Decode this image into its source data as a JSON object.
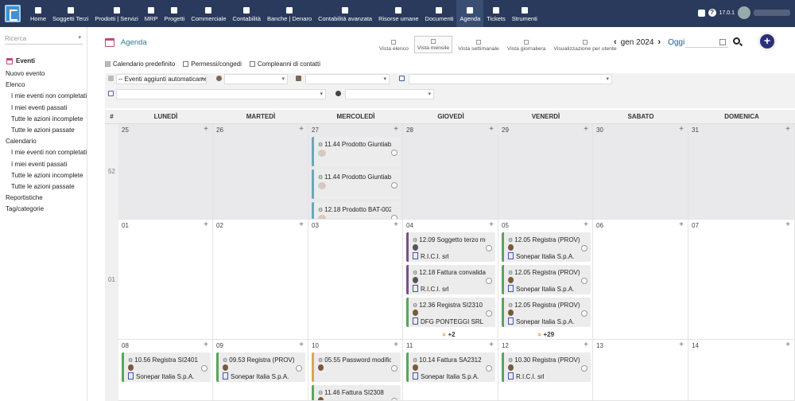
{
  "topbar": {
    "nav": [
      {
        "label": "Home",
        "icon": "home-icon"
      },
      {
        "label": "Soggetti Terzi",
        "icon": "building-icon"
      },
      {
        "label": "Prodotti | Servizi",
        "icon": "box-icon"
      },
      {
        "label": "MRP",
        "icon": "gears-icon"
      },
      {
        "label": "Progetti",
        "icon": "chart-icon"
      },
      {
        "label": "Commerciale",
        "icon": "briefcase-icon"
      },
      {
        "label": "Contabilità",
        "icon": "ledger-icon"
      },
      {
        "label": "Banche | Denaro",
        "icon": "bank-icon"
      },
      {
        "label": "Contabilità avanzata",
        "icon": "search-icon"
      },
      {
        "label": "Risorse umane",
        "icon": "user-icon"
      },
      {
        "label": "Documenti",
        "icon": "folder-icon"
      },
      {
        "label": "Agenda",
        "icon": "calendar-icon"
      },
      {
        "label": "Tickets",
        "icon": "ticket-icon"
      },
      {
        "label": "Strumenti",
        "icon": "wrench-icon"
      }
    ],
    "version": "17.0.1"
  },
  "sidebar": {
    "search_placeholder": "Ricerca",
    "section": "Eventi",
    "items": [
      {
        "label": "Nuovo evento",
        "sub": false
      },
      {
        "label": "Elenco",
        "sub": false
      },
      {
        "label": "I mie eventi non completati",
        "sub": true
      },
      {
        "label": "I miei eventi passati",
        "sub": true
      },
      {
        "label": "Tutte le azioni incomplete",
        "sub": true
      },
      {
        "label": "Tutte le azioni passate",
        "sub": true
      },
      {
        "label": "Calendario",
        "sub": false
      },
      {
        "label": "I mie eventi non completati",
        "sub": true
      },
      {
        "label": "I miei eventi passati",
        "sub": true
      },
      {
        "label": "Tutte le azioni incomplete",
        "sub": true
      },
      {
        "label": "Tutte le azioni passate",
        "sub": true
      },
      {
        "label": "Reportistiche",
        "sub": false
      },
      {
        "label": "Tag/categorie",
        "sub": false
      }
    ]
  },
  "header": {
    "title": "Agenda",
    "views": [
      "Vista elenco",
      "Vista mensile",
      "Vista settimanale",
      "Vista giornaliera",
      "Visualizzazione per utente"
    ],
    "active_view": 1,
    "month": "gen 2024",
    "today": "Oggi"
  },
  "checks": [
    {
      "label": "Calendario predefinito",
      "checked": true
    },
    {
      "label": "Permessi/congedi",
      "checked": false
    },
    {
      "label": "Compleanni di contatti",
      "checked": false
    }
  ],
  "filters": {
    "events_select": "-- Eventi aggiunti automaticamente --"
  },
  "calendar": {
    "week_header": "#",
    "days": [
      "LUNEDÌ",
      "MARTEDÌ",
      "MERCOLEDÌ",
      "GIOVEDÌ",
      "VENERDÌ",
      "SABATO",
      "DOMENICA"
    ],
    "weeks": [
      {
        "num": "52",
        "days": [
          {
            "d": "25",
            "grey": true,
            "events": []
          },
          {
            "d": "26",
            "grey": true,
            "events": []
          },
          {
            "d": "27",
            "grey": true,
            "events": [
              {
                "t": "11.44 Prodotto Giuntiabc",
                "c": "",
                "color": "#6aa7b8",
                "blur": true
              },
              {
                "t": "11.44 Prodotto Giuntiabc",
                "c": "",
                "color": "#6aa7b8",
                "blur": true
              },
              {
                "t": "12.18 Prodotto BAT-0021",
                "c": "",
                "color": "#6aa7b8",
                "blur": true
              }
            ],
            "more": "+1"
          },
          {
            "d": "28",
            "grey": true,
            "events": []
          },
          {
            "d": "29",
            "grey": true,
            "events": []
          },
          {
            "d": "30",
            "grey": true,
            "events": []
          },
          {
            "d": "31",
            "grey": true,
            "events": []
          }
        ]
      },
      {
        "num": "01",
        "days": [
          {
            "d": "01",
            "grey": false,
            "events": []
          },
          {
            "d": "02",
            "grey": false,
            "events": []
          },
          {
            "d": "03",
            "grey": false,
            "events": []
          },
          {
            "d": "04",
            "grey": false,
            "events": [
              {
                "t": "12.09 Soggetto terzo modificato",
                "c": "R.I.C.I. srl",
                "color": "#7b4f8c",
                "pg": true
              },
              {
                "t": "12.18 Fattura convalidata",
                "c": "R.I.C.I. srl",
                "color": "#7b4f8c",
                "pg": true
              },
              {
                "t": "12.36 Registra SI2310",
                "c": "DFG PONTEGGI SRL",
                "color": "#5aa55a"
              }
            ],
            "more": "+2"
          },
          {
            "d": "05",
            "grey": false,
            "events": [
              {
                "t": "12.05 Registra (PROV)",
                "c": "Sonepar Italia S.p.A.",
                "color": "#5aa55a"
              },
              {
                "t": "12.05 Registra (PROV)",
                "c": "Sonepar Italia S.p.A.",
                "color": "#5aa55a"
              },
              {
                "t": "12.05 Registra (PROV)",
                "c": "Sonepar Italia S.p.A.",
                "color": "#5aa55a"
              }
            ],
            "more": "+29"
          },
          {
            "d": "06",
            "grey": false,
            "events": []
          },
          {
            "d": "07",
            "grey": false,
            "events": []
          }
        ]
      },
      {
        "num": "",
        "days": [
          {
            "d": "08",
            "grey": false,
            "events": [
              {
                "t": "10.56 Registra SI2401",
                "c": "Sonepar Italia S.p.A.",
                "color": "#5aa55a"
              }
            ]
          },
          {
            "d": "09",
            "grey": false,
            "events": [
              {
                "t": "09.53 Registra (PROV)",
                "c": "Sonepar Italia S.p.A.",
                "color": "#5aa55a"
              }
            ]
          },
          {
            "d": "10",
            "grey": false,
            "events": [
              {
                "t": "05.55 Password modificata",
                "c": "",
                "color": "#d6a94a"
              },
              {
                "t": "11.46 Fattura SI2308",
                "c": "",
                "color": "#5aa55a"
              }
            ]
          },
          {
            "d": "11",
            "grey": false,
            "events": [
              {
                "t": "10.14 Fattura SA2312",
                "c": "Sonepar Italia S.p.A.",
                "color": "#5aa55a"
              }
            ]
          },
          {
            "d": "12",
            "grey": false,
            "events": [
              {
                "t": "10.30 Registra (PROV)",
                "c": "R.I.C.I. srl",
                "color": "#5aa55a"
              }
            ]
          },
          {
            "d": "13",
            "grey": false,
            "events": []
          },
          {
            "d": "14",
            "grey": false,
            "events": []
          }
        ]
      }
    ]
  }
}
